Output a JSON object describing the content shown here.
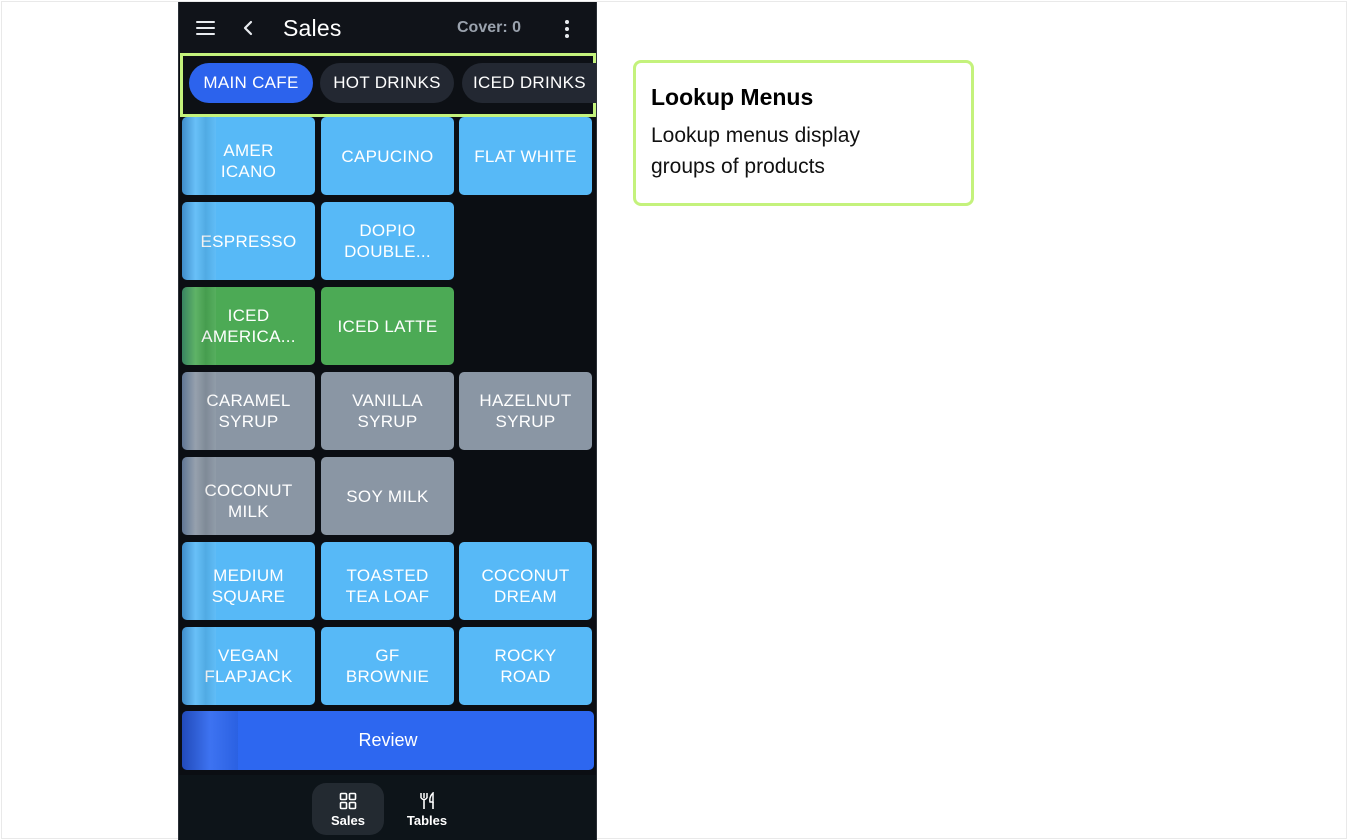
{
  "appbar": {
    "title": "Sales",
    "cover": "Cover: 0",
    "icons": [
      "menu-icon",
      "back-icon",
      "more-vertical-icon"
    ]
  },
  "tabs": [
    {
      "label": "MAIN CAFE",
      "active": true
    },
    {
      "label": "HOT DRINKS",
      "active": false
    },
    {
      "label": "ICED DRINKS",
      "active": false
    }
  ],
  "products": [
    {
      "label": "AMER\nICANO",
      "color": "#57b9f7"
    },
    {
      "label": "CAPUCINO",
      "color": "#57b9f7"
    },
    {
      "label": "FLAT WHITE",
      "color": "#57b9f7"
    },
    {
      "label": "ESPRESSO",
      "color": "#57b9f7"
    },
    {
      "label": "DOPIO\nDOUBLE...",
      "color": "#57b9f7"
    },
    {
      "label": "ICED\nAMERICA...",
      "color": "#4caa55"
    },
    {
      "label": "ICED LATTE",
      "color": "#4caa55"
    },
    {
      "label": "CARAMEL\nSYRUP",
      "color": "#8a96a4"
    },
    {
      "label": "VANILLA\nSYRUP",
      "color": "#8a96a4"
    },
    {
      "label": "HAZELNUT\nSYRUP",
      "color": "#8a96a4"
    },
    {
      "label": "COCONUT\nMILK",
      "color": "#8a96a4"
    },
    {
      "label": "SOY MILK",
      "color": "#8a96a4"
    },
    {
      "label": "MEDIUM\nSQUARE",
      "color": "#57b9f7"
    },
    {
      "label": "TOASTED\nTEA LOAF",
      "color": "#57b9f7"
    },
    {
      "label": "COCONUT\nDREAM",
      "color": "#57b9f7"
    },
    {
      "label": "VEGAN\nFLAPJACK",
      "color": "#57b9f7"
    },
    {
      "label": "GF\nBROWNIE",
      "color": "#57b9f7"
    },
    {
      "label": "ROCKY\nROAD",
      "color": "#57b9f7"
    }
  ],
  "review": {
    "label": "Review",
    "color": "#2d67f0"
  },
  "bottom_nav": [
    {
      "label": "Sales",
      "icon": "grid-icon",
      "active": true
    },
    {
      "label": "Tables",
      "icon": "fork-knife-icon",
      "active": false
    }
  ],
  "callout": {
    "title": "Lookup Menus",
    "body": "Lookup menus display groups of products",
    "border_color": "#c4f27c"
  }
}
